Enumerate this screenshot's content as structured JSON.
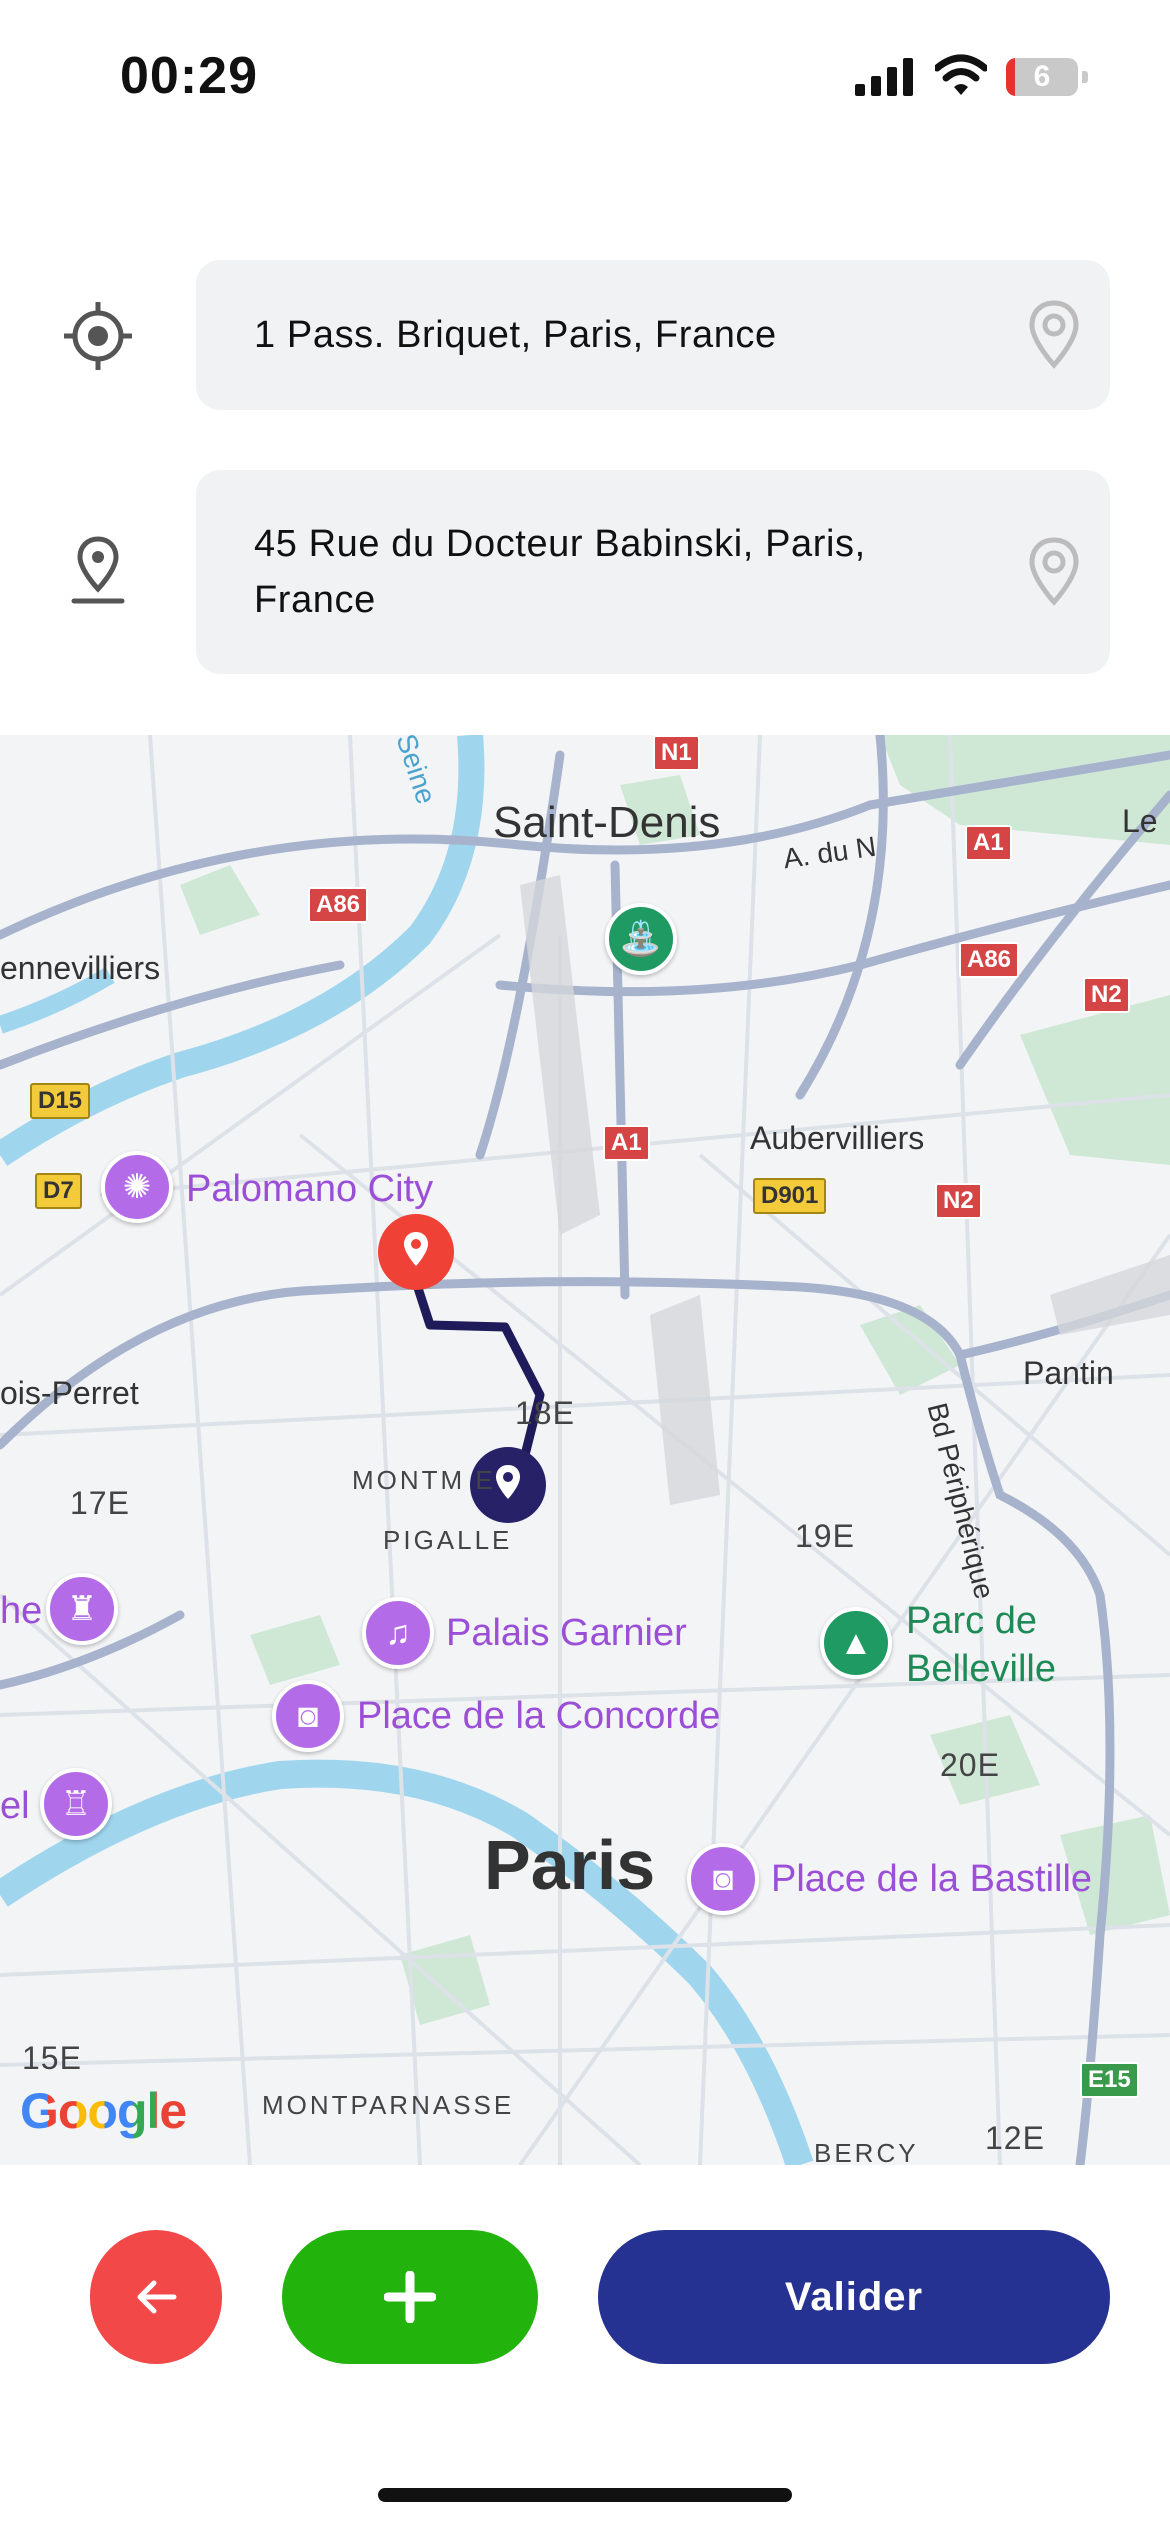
{
  "status_bar": {
    "time": "00:29",
    "battery_level": "6",
    "battery_fraction": 0.06
  },
  "route": {
    "origin": {
      "value": "1 Pass. Briquet, Paris, France",
      "icon": "crosshair-location-icon"
    },
    "destination": {
      "value": "45 Rue du Docteur Babinski, Paris, France",
      "icon": "location-pin-icon"
    }
  },
  "map": {
    "labels": {
      "saint_denis": "Saint-Denis",
      "paris": "Paris",
      "aubervilliers": "Aubervilliers",
      "pantin": "Pantin",
      "gennevilliers": "ennevilliers",
      "levallois": "ois-Perret",
      "le": "Le",
      "seine": "Seine",
      "a_du_n": "A. du N",
      "bd_peripherique": "Bd Périphérique",
      "montmartre": "MONTM    E",
      "pigalle": "PIGALLE",
      "montparnasse": "MONTPARNASSE",
      "bercy": "BERCY",
      "arr_18": "18E",
      "arr_17": "17E",
      "arr_19": "19E",
      "arr_20": "20E",
      "arr_15": "15E",
      "arr_12": "12E",
      "left_cut_1": "he",
      "left_cut_2": "el"
    },
    "pois": {
      "palomano": "Palomano City",
      "palais_garnier": "Palais Garnier",
      "concorde": "Place de la Concorde",
      "bastille": "Place de la Bastille",
      "belleville": "Parc de Belleville"
    },
    "shields": {
      "n1": "N1",
      "a86_left": "A86",
      "a1_top": "A1",
      "a86_right": "A86",
      "n2_top": "N2",
      "d15": "D15",
      "d7": "D7",
      "a1_mid": "A1",
      "d901": "D901",
      "n2_mid": "N2",
      "e15": "E15"
    },
    "attribution": "Google",
    "colors": {
      "route": "#1f1b5a",
      "origin_marker": "#ef4136",
      "destination_marker": "#272268"
    }
  },
  "actions": {
    "back_icon": "arrow-left-icon",
    "add_icon": "plus-icon",
    "validate_label": "Valider",
    "colors": {
      "back": "#f24848",
      "add": "#22b30d",
      "validate": "#263292"
    }
  }
}
